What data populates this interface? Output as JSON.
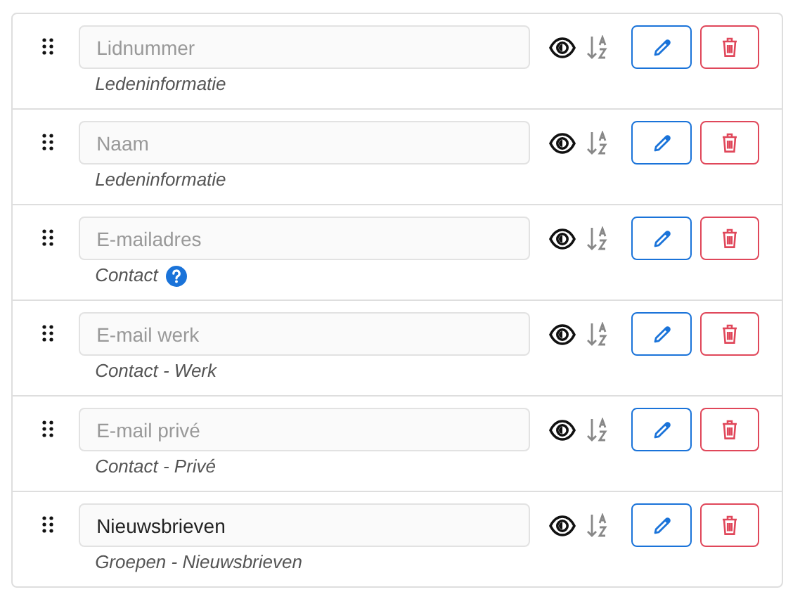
{
  "fields": [
    {
      "placeholder": "Lidnummer",
      "category": "Ledeninformatie",
      "help": false
    },
    {
      "placeholder": "Naam",
      "category": "Ledeninformatie",
      "help": false
    },
    {
      "placeholder": "E-mailadres",
      "category": "Contact",
      "help": true
    },
    {
      "placeholder": "E-mail werk",
      "category": "Contact - Werk",
      "help": false
    },
    {
      "placeholder": "E-mail privé",
      "category": "Contact - Privé",
      "help": false
    },
    {
      "value": "Nieuwsbrieven",
      "category": "Groepen - Nieuwsbrieven",
      "help": false
    }
  ]
}
